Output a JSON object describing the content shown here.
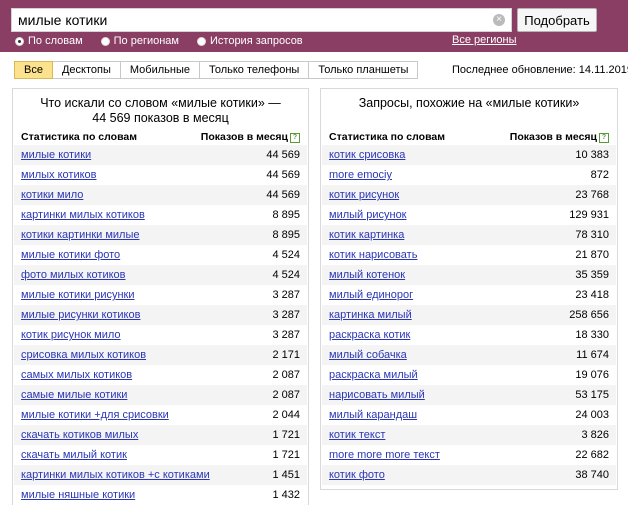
{
  "search": {
    "query": "милые котики",
    "submit_label": "Подобрать"
  },
  "modes": [
    {
      "label": "По словам",
      "selected": true
    },
    {
      "label": "По регионам",
      "selected": false
    },
    {
      "label": "История запросов",
      "selected": false
    }
  ],
  "all_regions_label": "Все регионы",
  "device_tabs": [
    {
      "label": "Все",
      "active": true
    },
    {
      "label": "Десктопы",
      "active": false
    },
    {
      "label": "Мобильные",
      "active": false
    },
    {
      "label": "Только телефоны",
      "active": false
    },
    {
      "label": "Только планшеты",
      "active": false
    }
  ],
  "last_update": "Последнее обновление: 14.11.2019",
  "left_panel": {
    "title": "Что искали со словом «милые котики» — 44 569 показов в месяц",
    "col_keyword": "Статистика по словам",
    "col_count": "Показов в месяц",
    "rows": [
      {
        "keyword": "милые котики",
        "count": "44 569"
      },
      {
        "keyword": "милых котиков",
        "count": "44 569"
      },
      {
        "keyword": "котики мило",
        "count": "44 569"
      },
      {
        "keyword": "картинки милых котиков",
        "count": "8 895"
      },
      {
        "keyword": "котики картинки милые",
        "count": "8 895"
      },
      {
        "keyword": "милые котики фото",
        "count": "4 524"
      },
      {
        "keyword": "фото милых котиков",
        "count": "4 524"
      },
      {
        "keyword": "милые котики рисунки",
        "count": "3 287"
      },
      {
        "keyword": "милые рисунки котиков",
        "count": "3 287"
      },
      {
        "keyword": "котик рисунок мило",
        "count": "3 287"
      },
      {
        "keyword": "срисовка милых котиков",
        "count": "2 171"
      },
      {
        "keyword": "самых милых котиков",
        "count": "2 087"
      },
      {
        "keyword": "самые милые котики",
        "count": "2 087"
      },
      {
        "keyword": "милые котики +для срисовки",
        "count": "2 044"
      },
      {
        "keyword": "скачать котиков милых",
        "count": "1 721"
      },
      {
        "keyword": "скачать милый котик",
        "count": "1 721"
      },
      {
        "keyword": "картинки милых котиков +с котиками",
        "count": "1 451"
      },
      {
        "keyword": "милые няшные котики",
        "count": "1 432"
      }
    ]
  },
  "right_panel": {
    "title": "Запросы, похожие на «милые котики»",
    "col_keyword": "Статистика по словам",
    "col_count": "Показов в месяц",
    "rows": [
      {
        "keyword": "котик срисовка",
        "count": "10 383"
      },
      {
        "keyword": "more emociy",
        "count": "872"
      },
      {
        "keyword": "котик рисунок",
        "count": "23 768"
      },
      {
        "keyword": "милый рисунок",
        "count": "129 931"
      },
      {
        "keyword": "котик картинка",
        "count": "78 310"
      },
      {
        "keyword": "котик нарисовать",
        "count": "21 870"
      },
      {
        "keyword": "милый котенок",
        "count": "35 359"
      },
      {
        "keyword": "милый единорог",
        "count": "23 418"
      },
      {
        "keyword": "картинка милый",
        "count": "258 656"
      },
      {
        "keyword": "раскраска котик",
        "count": "18 330"
      },
      {
        "keyword": "милый собачка",
        "count": "11 674"
      },
      {
        "keyword": "раскраска милый",
        "count": "19 076"
      },
      {
        "keyword": "нарисовать милый",
        "count": "53 175"
      },
      {
        "keyword": "милый карандаш",
        "count": "24 003"
      },
      {
        "keyword": "котик текст",
        "count": "3 826"
      },
      {
        "keyword": "more more more текст",
        "count": "22 682"
      },
      {
        "keyword": "котик фото",
        "count": "38 740"
      }
    ]
  },
  "colors": {
    "header_bg": "#8a3e64",
    "link": "#2a36b5",
    "active_tab": "#fce28d"
  }
}
